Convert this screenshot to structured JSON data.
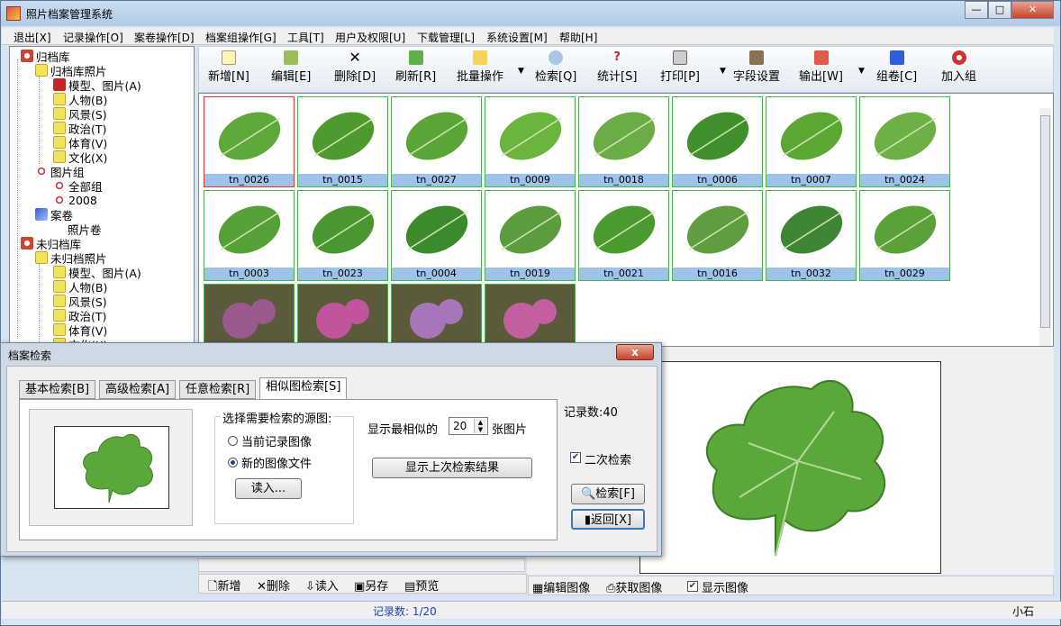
{
  "window": {
    "title": "照片档案管理系统",
    "controls": [
      "—",
      "□",
      "✕"
    ]
  },
  "menu": [
    "退出[X]",
    "记录操作[O]",
    "案卷操作[D]",
    "档案组操作[G]",
    "工具[T]",
    "用户及权限[U]",
    "下载管理[L]",
    "系统设置[M]",
    "帮助[H]"
  ],
  "tree": {
    "items": [
      {
        "label": "归档库",
        "icon": "archive-icon"
      },
      {
        "label": "归档库照片",
        "icon": "person-icon"
      },
      {
        "label": "模型、图片(A)",
        "icon": "book-icon"
      },
      {
        "label": "人物(B)",
        "icon": "person-icon"
      },
      {
        "label": "风景(S)",
        "icon": "person-icon"
      },
      {
        "label": "政治(T)",
        "icon": "person-icon"
      },
      {
        "label": "体育(V)",
        "icon": "person-icon"
      },
      {
        "label": "文化(X)",
        "icon": "person-icon"
      },
      {
        "label": "图片组",
        "icon": "group-icon"
      },
      {
        "label": "全部组",
        "icon": "group-icon"
      },
      {
        "label": "2008",
        "icon": "group-icon"
      },
      {
        "label": "案卷",
        "icon": "volume-icon"
      },
      {
        "label": "照片卷",
        "icon": ""
      },
      {
        "label": "未归档库",
        "icon": "archive-icon"
      },
      {
        "label": "未归档照片",
        "icon": "person-icon"
      },
      {
        "label": "模型、图片(A)",
        "icon": "person-icon"
      },
      {
        "label": "人物(B)",
        "icon": "person-icon"
      },
      {
        "label": "风景(S)",
        "icon": "person-icon"
      },
      {
        "label": "政治(T)",
        "icon": "person-icon"
      },
      {
        "label": "体育(V)",
        "icon": "person-icon"
      },
      {
        "label": "文化(X)",
        "icon": "person-icon"
      }
    ]
  },
  "toolbar": {
    "buttons": [
      {
        "label": "新增[N]",
        "icon": "new-icon"
      },
      {
        "label": "编辑[E]",
        "icon": "edit-icon"
      },
      {
        "label": "删除[D]",
        "icon": "delete-icon"
      },
      {
        "label": "刷新[R]",
        "icon": "refresh-icon"
      },
      {
        "label": "批量操作",
        "icon": "batch-icon"
      },
      {
        "label": "检索[Q]",
        "icon": "search-icon"
      },
      {
        "label": "统计[S]",
        "icon": "stats-icon"
      },
      {
        "label": "打印[P]",
        "icon": "print-icon"
      },
      {
        "label": "字段设置",
        "icon": "field-settings-icon"
      },
      {
        "label": "输出[W]",
        "icon": "export-icon"
      },
      {
        "label": "组卷[C]",
        "icon": "volume-icon"
      },
      {
        "label": "加入组",
        "icon": "group-icon"
      }
    ]
  },
  "thumbnails": [
    {
      "label": "tn_0026",
      "color": "#5fa83a"
    },
    {
      "label": "tn_0015",
      "color": "#4e9a2e"
    },
    {
      "label": "tn_0027",
      "color": "#5aa535"
    },
    {
      "label": "tn_0009",
      "color": "#6bb53e"
    },
    {
      "label": "tn_0018",
      "color": "#6aac45"
    },
    {
      "label": "tn_0006",
      "color": "#3f8f2a"
    },
    {
      "label": "tn_0007",
      "color": "#5ca734"
    },
    {
      "label": "tn_0024",
      "color": "#6cb046"
    },
    {
      "label": "tn_0003",
      "color": "#55a037"
    },
    {
      "label": "tn_0023",
      "color": "#4a9630"
    },
    {
      "label": "tn_0004",
      "color": "#3b8a2c"
    },
    {
      "label": "tn_0019",
      "color": "#5b9c3c"
    },
    {
      "label": "tn_0021",
      "color": "#4a9a30"
    },
    {
      "label": "tn_0016",
      "color": "#609d40"
    },
    {
      "label": "tn_0032",
      "color": "#3e8536"
    },
    {
      "label": "tn_0029",
      "color": "#5aa13a"
    }
  ],
  "flower_thumbs": [
    "#9b5a8e",
    "#c0559e",
    "#a876b8",
    "#c2609f"
  ],
  "bottombar": {
    "new": "新增",
    "delete": "删除",
    "import": "读入",
    "save_as": "另存",
    "preview": "预览"
  },
  "preview_bar": {
    "edit_image": "编辑图像",
    "get_image": "获取图像",
    "show_image": "显示图像",
    "show_checked": true
  },
  "status": {
    "count": "记录数: 1/20",
    "user": "小石"
  },
  "dialog": {
    "title": "档案检索",
    "close": "x",
    "tabs": [
      "基本检索[B]",
      "高级检索[A]",
      "任意检索[R]",
      "相似图检索[S]"
    ],
    "active_tab": 3,
    "source_title": "选择需要检索的源图:",
    "radio_current": "当前记录图像",
    "radio_new": "新的图像文件",
    "selected_radio": "new",
    "load_button": "读入...",
    "show_most_similar_prefix": "显示最相似的",
    "show_count": "20",
    "show_most_similar_suffix": "张图片",
    "show_last_button": "显示上次检索结果",
    "record_count": "记录数:40",
    "second_search_label": "二次检索",
    "second_search_checked": true,
    "search_button": "检索[F]",
    "back_button": "返回[X]"
  }
}
